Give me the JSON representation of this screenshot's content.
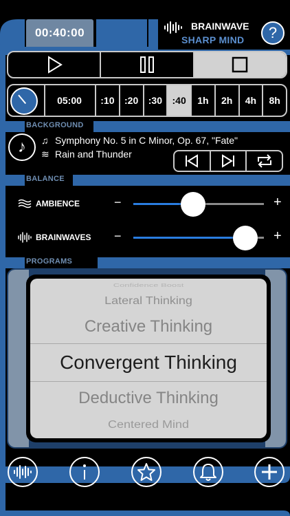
{
  "header": {
    "timer": "00:40:00",
    "brand_line1": "BRAINWAVE",
    "brand_line2": "SHARP MIND",
    "help_label": "?"
  },
  "duration": {
    "value": "05:00",
    "presets": [
      ":10",
      ":20",
      ":30",
      ":40",
      "1h",
      "2h",
      "4h",
      "8h"
    ],
    "selected_index": 3
  },
  "sections": {
    "background": "BACKGROUND",
    "balance": "BALANCE",
    "programs": "PROGRAMS"
  },
  "background": {
    "track": "Symphony No. 5 in C Minor, Op. 67, \"Fate\"",
    "ambience_track": "Rain and Thunder"
  },
  "balance": {
    "ambience_label": "AMBIENCE",
    "brainwaves_label": "BRAINWAVES",
    "minus": "−",
    "plus": "+",
    "ambience_level": 0.46,
    "brainwaves_level": 0.86
  },
  "programs": {
    "items": [
      "Confidence Boost",
      "Lateral Thinking",
      "Creative Thinking",
      "Convergent Thinking",
      "Deductive Thinking",
      "Centered Mind"
    ],
    "selected": "Convergent Thinking"
  },
  "colors": {
    "accent_blue": "#2f67a8",
    "slider_fill": "#2a7de0",
    "picker_bg": "#d5d5d5"
  }
}
